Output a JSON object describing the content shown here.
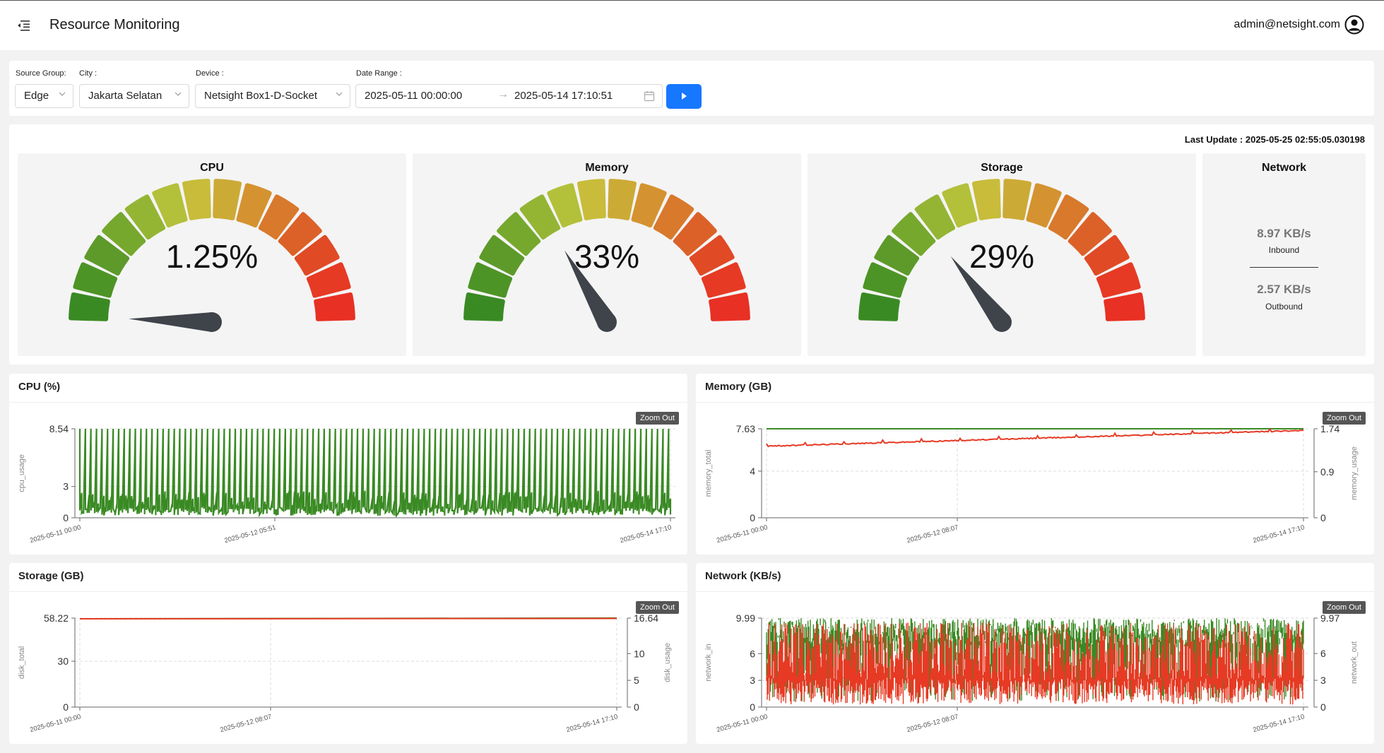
{
  "header": {
    "title": "Resource Monitoring",
    "user_email": "admin@netsight.com",
    "menu_icon": "menu-fold-icon",
    "user_icon": "user-circle-icon"
  },
  "filters": {
    "source_group": {
      "label": "Source Group:",
      "value": "Edge"
    },
    "city": {
      "label": "City :",
      "value": "Jakarta Selatan"
    },
    "device": {
      "label": "Device :",
      "value": "Netsight Box1-D-Socket"
    },
    "date_range": {
      "label": "Date Range :",
      "start": "2025-05-11 00:00:00",
      "arrow": "→",
      "end": "2025-05-14 17:10:51"
    },
    "submit_icon": "play-icon"
  },
  "last_update": "Last Update : 2025-05-25 02:55:05.030198",
  "gauges": [
    {
      "title": "CPU",
      "value_text": "1.25%",
      "value": 1.25
    },
    {
      "title": "Memory",
      "value_text": "33%",
      "value": 33
    },
    {
      "title": "Storage",
      "value_text": "29%",
      "value": 29
    }
  ],
  "network": {
    "title": "Network",
    "inbound_value": "8.97 KB/s",
    "inbound_label": "Inbound",
    "outbound_value": "2.57 KB/s",
    "outbound_label": "Outbound"
  },
  "colors": {
    "green": "#3a8a24",
    "red": "#e63a24",
    "accent": "#1677ff",
    "needle": "#3f434a"
  },
  "zoom_label": "Zoom Out",
  "chart_data": [
    {
      "type": "line",
      "title": "CPU (%)",
      "ylabel": "cpu_usage",
      "ylim": [
        0,
        8.54
      ],
      "y_ticks": [
        "8.54",
        "3",
        "0"
      ],
      "x_ticks": [
        "2025-05-11 00:00",
        "2025-05-12 05:51",
        "2025-05-14 17:10"
      ],
      "series": [
        {
          "values_summary": "baseline around 0.5-2.5 with frequent periodic spikes up to 8.54"
        }
      ]
    },
    {
      "type": "line",
      "title": "Memory (GB)",
      "ylabel": "memory_total",
      "y2label": "memory_usage",
      "ylim": [
        0,
        7.63
      ],
      "y2lim": [
        0,
        1.74
      ],
      "y_ticks": [
        "7.63",
        "4",
        "0"
      ],
      "y2_ticks": [
        "1.74",
        "0.9",
        "0"
      ],
      "x_ticks": [
        "2025-05-11 00:00",
        "2025-05-12 08:07",
        "2025-05-14 17:10"
      ],
      "series": [
        {
          "values_summary": "memory_total constant at 7.63"
        },
        {
          "values_summary": "memory_usage rising from about 1.4 to 1.7"
        }
      ]
    },
    {
      "type": "line",
      "title": "Storage (GB)",
      "ylabel": "disk_total",
      "y2label": "disk_usage",
      "ylim": [
        0,
        58.22
      ],
      "y2lim": [
        0,
        16.64
      ],
      "y_ticks": [
        "58.22",
        "30",
        "0"
      ],
      "y2_ticks": [
        "16.64",
        "10",
        "5",
        "0"
      ],
      "x_ticks": [
        "2025-05-11 00:00",
        "2025-05-12 08:07",
        "2025-05-14 17:10"
      ],
      "series": [
        {
          "values_summary": "disk_total constant at 58.22"
        },
        {
          "values_summary": "disk_usage nearly constant near 16.64"
        }
      ]
    },
    {
      "type": "line",
      "title": "Network (KB/s)",
      "ylabel": "network_in",
      "y2label": "network_out",
      "ylim": [
        0,
        9.99
      ],
      "y2lim": [
        0,
        9.97
      ],
      "y_ticks": [
        "9.99",
        "6",
        "3",
        "0"
      ],
      "y2_ticks": [
        "9.97",
        "6",
        "3",
        "0"
      ],
      "x_ticks": [
        "2025-05-11 00:00",
        "2025-05-12 08:07",
        "2025-05-14 17:10"
      ],
      "series": [
        {
          "values_summary": "network_in highly volatile between 0 and 9.99"
        },
        {
          "values_summary": "network_out highly volatile between 0 and 9.97"
        }
      ]
    }
  ]
}
